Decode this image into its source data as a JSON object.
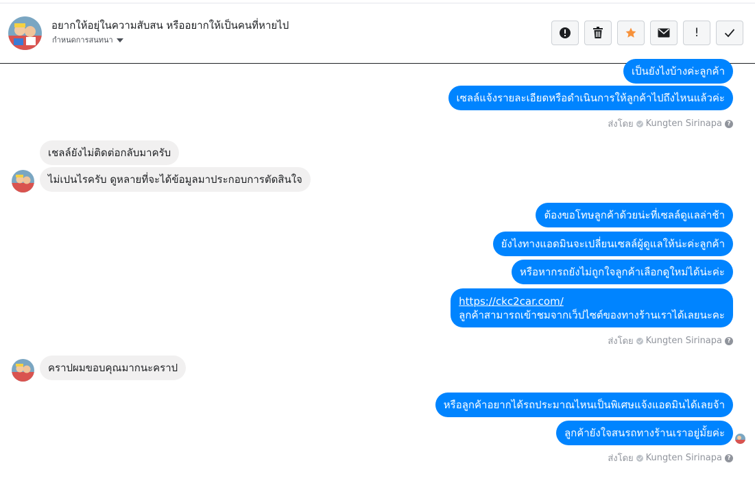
{
  "header": {
    "title": "อยากให้อยุ่ในความสับสน หรืออยากให้เป็นคนที่หายไป",
    "subtitle": "กำหนดการสนทนา",
    "actions": [
      {
        "name": "alert-circle-icon"
      },
      {
        "name": "trash-icon"
      },
      {
        "name": "star-icon",
        "color": "#f7923b"
      },
      {
        "name": "envelope-icon"
      },
      {
        "name": "exclamation-icon",
        "text": "!"
      },
      {
        "name": "checkmark-icon"
      }
    ]
  },
  "messages": [
    {
      "side": "out",
      "text": "เป็นยังไงบ้างค่ะลูกค้า"
    },
    {
      "side": "out",
      "text": "เซลล์แจ้งรายละเอียดหรือดำเนินการให้ลูกค้าไปถึงไหนแล้วค่ะ"
    },
    {
      "side": "in",
      "text": "เชลล์ยังไม่ติดต่อกลับมาครับ"
    },
    {
      "side": "in",
      "text": "ไม่เปนไรครับ ดูหลายที่จะได้ข้อมูลมาประกอบการตัดสินใจ"
    },
    {
      "side": "out",
      "text": "ต้องขอโทษลูกค้าด้วยน่ะที่เซลล์ดูแลล่าช้า"
    },
    {
      "side": "out",
      "text": "ยังไงทางแอดมินจะเปลี่ยนเซลล์ผู้ดูแลให้น่ะค่ะลูกค้า"
    },
    {
      "side": "out",
      "text": "หรือหากรถยังไม่ถูกใจลูกค้าเลือกดูใหม่ได้น่ะค่ะ"
    },
    {
      "side": "out",
      "link": "https://ckc2car.com/",
      "text": "ลูกค้าสามารถเข้าชมจากเว็ปไซต์ของทางร้านเราได้เลยนะคะ"
    },
    {
      "side": "in",
      "text": "คราปผมขอบคุณมากนะคราป"
    },
    {
      "side": "out",
      "text": "หรือลูกค้าอยากได้รถประมาณไหนเป็นพิเศษแจ้งแอดมินได้เลยจ้า"
    },
    {
      "side": "out",
      "text": "ลูกค้ายังใจสนรถทางร้านเราอยู่มั้ยค่ะ"
    }
  ],
  "sent_by": {
    "prefix": "ส่งโดย",
    "name": "Kungten Sirinapa"
  },
  "colors": {
    "outgoing": "#0084ff",
    "incoming": "#f1f0f0",
    "accent_star": "#f7923b"
  }
}
